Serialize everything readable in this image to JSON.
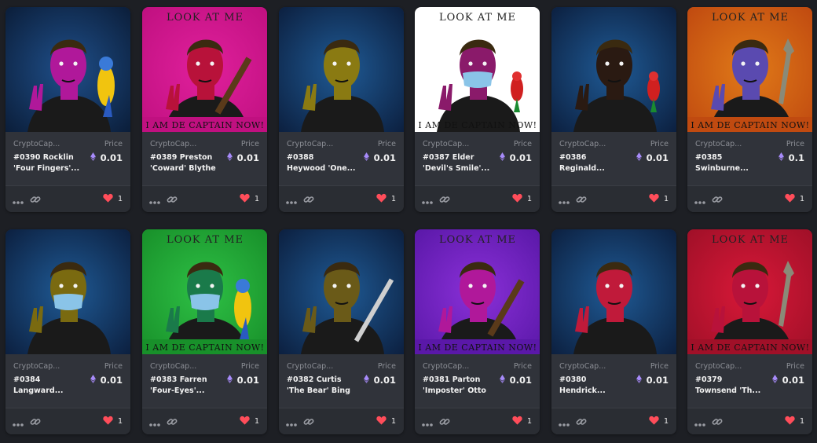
{
  "grid": {
    "cards": [
      {
        "collection": "CryptoCap...",
        "name_l1": "#0390 Rocklin",
        "name_l2": "'Four Fingers'...",
        "price_label": "Price",
        "price": "0.01",
        "likes": "1",
        "bg1": "#1f4f8a",
        "bg2": "#0b1e3a",
        "skin": "#b0189a",
        "banner": false,
        "white_bg": false,
        "prop": "parrot-blue",
        "mask": false
      },
      {
        "collection": "CryptoCap...",
        "name_l1": "#0389 Preston",
        "name_l2": "'Coward' Blythe",
        "price_label": "Price",
        "price": "0.01",
        "likes": "1",
        "bg1": "#e0209c",
        "bg2": "#c01080",
        "skin": "#b8123a",
        "banner": true,
        "white_bg": false,
        "prop": "gun",
        "mask": false,
        "banner_top": "LOOK AT ME",
        "banner_bottom": "I AM DE CAPTAIN NOW!"
      },
      {
        "collection": "CryptoCap...",
        "name_l1": "#0388",
        "name_l2": "Heywood 'One...",
        "price_label": "Price",
        "price": "0.01",
        "likes": "1",
        "bg1": "#1f5a95",
        "bg2": "#0c2040",
        "skin": "#8a7a12",
        "banner": false,
        "white_bg": false,
        "prop": "none",
        "mask": false
      },
      {
        "collection": "CryptoCap...",
        "name_l1": "#0387 Elder",
        "name_l2": "'Devil's Smile'...",
        "price_label": "Price",
        "price": "0.01",
        "likes": "1",
        "bg1": "#ffffff",
        "bg2": "#ffffff",
        "skin": "#8a1a6a",
        "banner": true,
        "white_bg": true,
        "prop": "parrot-red",
        "mask": true,
        "banner_top": "LOOK AT ME",
        "banner_bottom": "I AM DE CAPTAIN NOW!"
      },
      {
        "collection": "CryptoCap...",
        "name_l1": "#0386",
        "name_l2": "Reginald...",
        "price_label": "Price",
        "price": "0.01",
        "likes": "1",
        "bg1": "#1f5a95",
        "bg2": "#0c2040",
        "skin": "#2a1a12",
        "banner": false,
        "white_bg": false,
        "prop": "parrot-red",
        "mask": false
      },
      {
        "collection": "CryptoCap...",
        "name_l1": "#0385",
        "name_l2": "Swinburne...",
        "price_label": "Price",
        "price": "0.1",
        "likes": "1",
        "bg1": "#e07a18",
        "bg2": "#c04a10",
        "skin": "#5a4ab0",
        "banner": true,
        "white_bg": false,
        "prop": "rocket",
        "mask": false,
        "banner_top": "LOOK AT ME",
        "banner_bottom": "I AM DE CAPTAIN NOW!"
      },
      {
        "collection": "CryptoCap...",
        "name_l1": "#0384",
        "name_l2": "Langward...",
        "price_label": "Price",
        "price": "0.01",
        "likes": "1",
        "bg1": "#1f5a95",
        "bg2": "#0c2040",
        "skin": "#7a6a10",
        "banner": false,
        "white_bg": false,
        "prop": "none",
        "mask": true
      },
      {
        "collection": "CryptoCap...",
        "name_l1": "#0383 Farren",
        "name_l2": "'Four-Eyes'...",
        "price_label": "Price",
        "price": "0.01",
        "likes": "1",
        "bg1": "#2ec045",
        "bg2": "#18902a",
        "skin": "#1a7a4a",
        "banner": true,
        "white_bg": false,
        "prop": "parrot-blue",
        "mask": true,
        "banner_top": "LOOK AT ME",
        "banner_bottom": "I AM DE CAPTAIN NOW!"
      },
      {
        "collection": "CryptoCap...",
        "name_l1": "#0382 Curtis",
        "name_l2": "'The Bear' Bing",
        "price_label": "Price",
        "price": "0.01",
        "likes": "1",
        "bg1": "#1f5a95",
        "bg2": "#0c2040",
        "skin": "#6a5a18",
        "banner": false,
        "white_bg": false,
        "prop": "sword",
        "mask": false
      },
      {
        "collection": "CryptoCap...",
        "name_l1": "#0381 Parton",
        "name_l2": "'Imposter' Otto",
        "price_label": "Price",
        "price": "0.01",
        "likes": "1",
        "bg1": "#8a30d8",
        "bg2": "#5a18a8",
        "skin": "#b0189a",
        "banner": true,
        "white_bg": false,
        "prop": "gun",
        "mask": false,
        "banner_top": "LOOK AT ME",
        "banner_bottom": "I AM DE CAPTAIN NOW!"
      },
      {
        "collection": "CryptoCap...",
        "name_l1": "#0380",
        "name_l2": "Hendrick...",
        "price_label": "Price",
        "price": "0.01",
        "likes": "1",
        "bg1": "#1f5a95",
        "bg2": "#0c2040",
        "skin": "#c01a3a",
        "banner": false,
        "white_bg": false,
        "prop": "none",
        "mask": false
      },
      {
        "collection": "CryptoCap...",
        "name_l1": "#0379",
        "name_l2": "Townsend 'Th...",
        "price_label": "Price",
        "price": "0.01",
        "likes": "1",
        "bg1": "#d81838",
        "bg2": "#a01028",
        "skin": "#b8123a",
        "banner": true,
        "white_bg": false,
        "prop": "rocket",
        "mask": false,
        "banner_top": "LOOK AT ME",
        "banner_bottom": "I AM DE CAPTAIN NOW!"
      }
    ]
  },
  "colors": {
    "page_bg": "#1d1f24",
    "card_bg": "#30333a",
    "footer_bg": "#2a2d33",
    "heart": "#ff4d5a",
    "eth": "#a78bfa",
    "muted_text": "#8c8f96"
  },
  "icons": {
    "more": "more-horizontal-icon",
    "link": "link-icon",
    "heart": "heart-icon",
    "eth": "ethereum-icon"
  }
}
